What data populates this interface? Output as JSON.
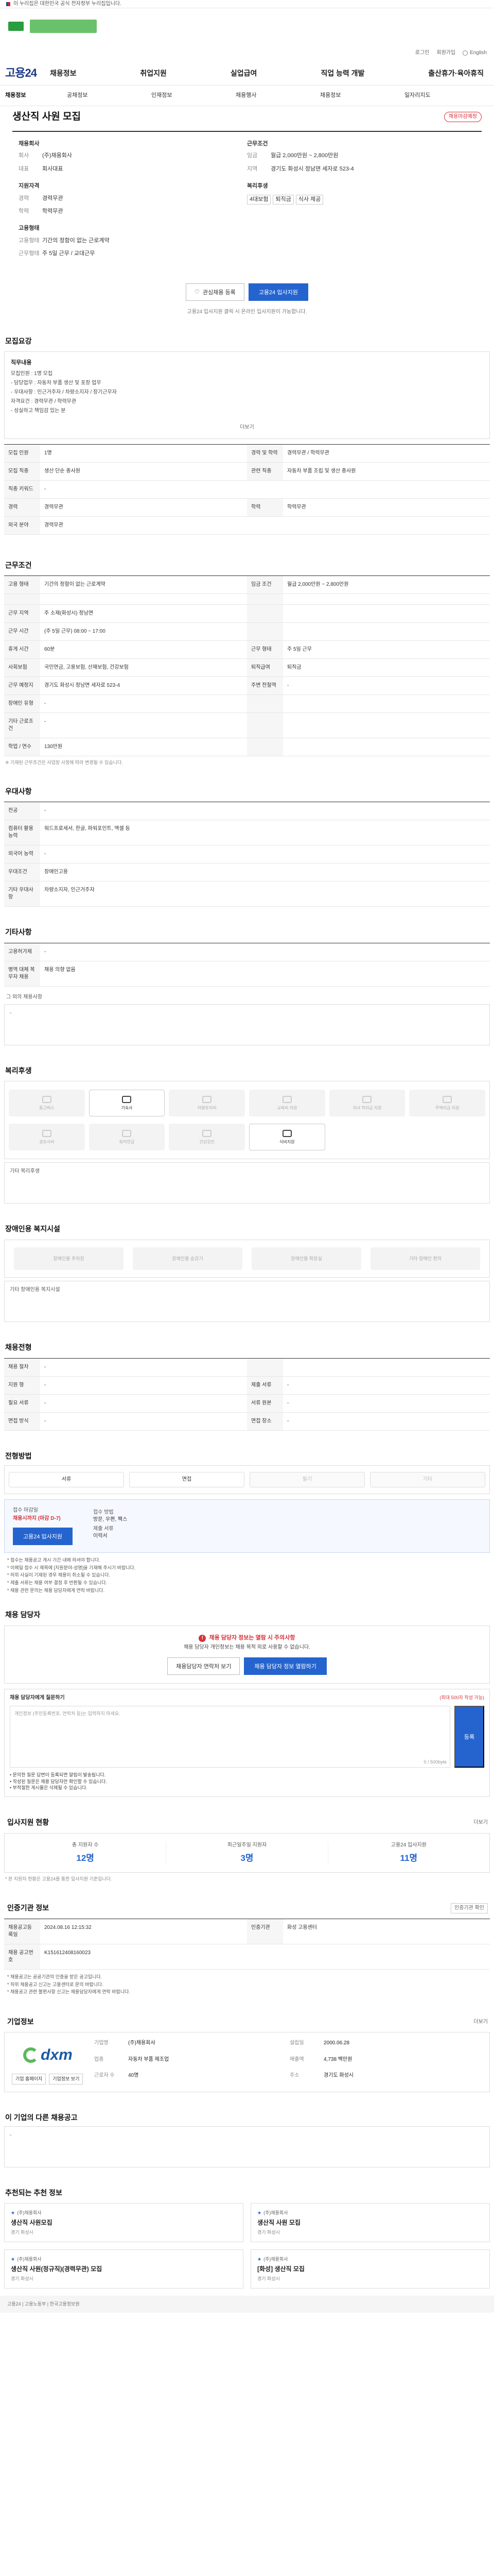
{
  "gov_bar": {
    "text": "이 누리집은 대한민국 공식 전자정부 누리집입니다."
  },
  "util": {
    "links": [
      "로그인",
      "회원가입",
      "English"
    ]
  },
  "header": {
    "logo": "고용24",
    "gnb": [
      "채용정보",
      "취업지원",
      "실업급여",
      "직업 능력 개발",
      "출산휴가·육아휴직"
    ]
  },
  "subnav": [
    "채용정보",
    "공채정보",
    "인재정보",
    "채용행사",
    "채용정보",
    "일자리지도"
  ],
  "title": {
    "text": "생산직 사원 모집",
    "badge": "채용마감예정"
  },
  "summary": {
    "company_head": "채용회사",
    "company_rows": [
      {
        "k": "회사",
        "v": "(주)채용회사"
      },
      {
        "k": "대표",
        "v": "회사대표"
      }
    ],
    "conditions_head": "근무조건",
    "conditions_rows": [
      {
        "k": "임금",
        "v": "월급 2,000만원 ~ 2,800만원"
      },
      {
        "k": "지역",
        "v": "경기도 화성시 정남면 세자로 523-4"
      }
    ],
    "qual_head": "지원자격",
    "qual_rows": [
      {
        "k": "경력",
        "v": "경력무관"
      },
      {
        "k": "학력",
        "v": "학력무관"
      }
    ],
    "type_head": "고용형태",
    "type_rows": [
      {
        "k": "고용형태",
        "v": "기간의 정함이 없는 근로계약"
      },
      {
        "k": "근무형태",
        "v": "주 5일 근무 / 교대근무"
      }
    ],
    "benefit_head": "복리후생",
    "benefits": [
      "4대보험",
      "퇴직금",
      "식사 제공"
    ],
    "btn_save": "관심채용 등록",
    "btn_apply": "고용24 입사지원",
    "note": "고용24 입사지원 클릭 시 온라인 입사지원이 가능합니다."
  },
  "s_recruit": {
    "title": "모집요강",
    "card_head": "직무내용",
    "items": [
      "모집인원 : 1명 모집",
      "- 담당업무 : 자동차 부품 생산 및 포장 업무",
      "- 우대사항 : 인근거주자 / 차량소지자 / 장기근무자",
      "자격요건 : 경력무관 / 학력무관",
      "- 성실하고 책임감 있는 분"
    ],
    "more": "더보기",
    "rows": [
      [
        {
          "k": "모집 인원",
          "v": "1명"
        },
        {
          "k": "경력 및 학력",
          "v": "경력무관 / 학력무관"
        }
      ],
      [
        {
          "k": "모집 직종",
          "v": "생산 단순 종사원"
        },
        {
          "k": "관련 직종",
          "v": "자동차 부품 조립 및 생산 종사원"
        }
      ],
      [
        {
          "k": "직종 키워드",
          "v": "-"
        },
        {
          "k": "",
          "v": ""
        }
      ],
      [
        {
          "k": "경력",
          "v": "경력무관"
        },
        {
          "k": "학력",
          "v": "학력무관"
        }
      ],
      [
        {
          "k": "외국 분야",
          "v": "경력무관"
        },
        {
          "k": "",
          "v": ""
        }
      ]
    ]
  },
  "s_work": {
    "title": "근무조건",
    "rows": [
      [
        {
          "k": "고용 형태",
          "v": "기간의 정함이 없는 근로계약"
        },
        {
          "k": "임금 조건",
          "v": "월급 2,000만원 ~ 2,800만원"
        }
      ],
      [
        {
          "k": "",
          "v": ""
        },
        {
          "k": "",
          "v": ""
        }
      ],
      [
        {
          "k": "근무 지역",
          "v": "주 소재(화성시) 정남면"
        },
        {
          "k": "",
          "v": ""
        }
      ],
      [
        {
          "k": "근무 시간",
          "v": "(주 5일 근무) 08:00 ~ 17:00"
        },
        {
          "k": "",
          "v": ""
        }
      ],
      [
        {
          "k": "휴게 시간",
          "v": "60분"
        },
        {
          "k": "근무 형태",
          "v": "주 5일 근무"
        }
      ],
      [
        {
          "k": "사회보험",
          "v": "국민연금, 고용보험, 산재보험, 건강보험"
        },
        {
          "k": "퇴직급여",
          "v": "퇴직금"
        }
      ],
      [
        {
          "k": "근무 예정지",
          "v": "경기도 화성시 정남면 세자로 523-4"
        },
        {
          "k": "주변 전철역",
          "v": "-"
        }
      ],
      [
        {
          "k": "장애인 유형",
          "v": "-"
        },
        {
          "k": "",
          "v": ""
        }
      ],
      [
        {
          "k": "기타 근로조건",
          "v": "-"
        },
        {
          "k": "",
          "v": ""
        }
      ],
      [
        {
          "k": "학업 / 연수",
          "v": "130만원"
        },
        {
          "k": "",
          "v": ""
        }
      ]
    ],
    "note": "※ 기재된 근무조건은 사업장 사정에 따라 변경될 수 있습니다."
  },
  "s_pref": {
    "title": "우대사항",
    "rows": [
      [
        {
          "k": "전공",
          "v": "-"
        }
      ],
      [
        {
          "k": "컴퓨터 활용 능력",
          "v": "워드프로세서, 한글, 파워포인트, 엑셀 등"
        }
      ],
      [
        {
          "k": "외국어 능력",
          "v": "-"
        }
      ],
      [
        {
          "k": "우대조건",
          "v": "장애인고용"
        }
      ],
      [
        {
          "k": "기타 우대사항",
          "v": "차량소지자, 인근거주자"
        }
      ]
    ]
  },
  "s_etc": {
    "title": "기타사항",
    "rows": [
      [
        {
          "k": "고용허가제",
          "v": "-"
        }
      ],
      [
        {
          "k": "병역 대체 복무자 채용",
          "v": "채용 의향 없음"
        }
      ]
    ],
    "empty": "그 외의 채용사항"
  },
  "s_benefit": {
    "title": "복리후생",
    "icons": [
      {
        "label": "통근버스",
        "on": false
      },
      {
        "label": "기숙사",
        "on": true
      },
      {
        "label": "차량유지비",
        "on": false
      },
      {
        "label": "교육비 지원",
        "on": false
      },
      {
        "label": "자녀 학자금 지원",
        "on": false
      },
      {
        "label": "주택자금 지원",
        "on": false
      },
      {
        "label": "경조사비",
        "on": false
      },
      {
        "label": "퇴직연금",
        "on": false
      },
      {
        "label": "건강검진",
        "on": false
      },
      {
        "label": "식비지원",
        "on": true
      }
    ],
    "empty": "기타 복리후생"
  },
  "s_disabled": {
    "title": "장애인용 복지시설",
    "chips": [
      "장애인용 주차장",
      "장애인용 승강기",
      "장애인용 화장실",
      "기타 장애인 편의"
    ],
    "empty": "기타 장애인용 복지시설"
  },
  "s_process": {
    "title": "채용전형",
    "rows": [
      [
        {
          "k": "채용 절차",
          "v": "-"
        },
        {
          "k": "",
          "v": ""
        }
      ],
      [
        {
          "k": "지원 형",
          "v": "-"
        },
        {
          "k": "제출 서류",
          "v": "-"
        }
      ],
      [
        {
          "k": "필요 서류",
          "v": "-"
        },
        {
          "k": "서류 원본",
          "v": "-"
        }
      ],
      [
        {
          "k": "면접 방식",
          "v": "-"
        },
        {
          "k": "면접 장소",
          "v": "-"
        }
      ]
    ]
  },
  "s_method": {
    "title": "전형방법",
    "methods": [
      {
        "label": "서류",
        "on": true
      },
      {
        "label": "면접",
        "on": true
      },
      {
        "label": "필기",
        "on": false
      },
      {
        "label": "기타",
        "on": false
      }
    ],
    "apply_deadline_k": "접수 마감일",
    "apply_deadline_v": "채용시까지 (마감 D-7)",
    "apply_method_k": "접수 방법",
    "apply_method_v": "방문, 우편, 팩스",
    "submit_k": "제출 서류",
    "submit_v": "이력서",
    "btn": "고용24 입사지원",
    "notes": [
      "* 접수는 채용공고 게시 기간 내에 하셔야 합니다.",
      "* 이메일 접수 시 제목에 [지원분야-성명]을 기재해 주시기 바랍니다.",
      "* 허위 사실이 기재된 경우 채용이 취소될 수 있습니다.",
      "* 제출 서류는 채용 여부 결정 후 반환될 수 있습니다.",
      "* 채용 관련 문의는 채용 담당자에게 연락 바랍니다."
    ]
  },
  "s_contact": {
    "title": "채용 담당자",
    "warn_title": "채용 담당자 정보는 열람 시 주의사항",
    "warn_text": "채용 담당자 개인정보는 채용 목적 외로 사용할 수 없습니다.",
    "btn1": "채용담당자 연락처 보기",
    "btn2": "채용 담당자 정보 열람하기",
    "comment_head": "채용 담당자에게 질문하기",
    "comment_hint": "(최대 500자 작성 가능)",
    "comment_placeholder": "개인정보 (주민등록번호, 연락처 등)는 입력하지 마세요.",
    "comment_count": "0 / 500byte",
    "comment_btn": "등록",
    "comment_list": [
      "• 문의한 질문 답변이 등록되면 알림이 발송됩니다.",
      "• 작성된 질문은 채용 담당자만 확인할 수 있습니다.",
      "• 부적절한 게시물은 삭제될 수 있습니다."
    ]
  },
  "s_stats": {
    "title": "입사지원 현황",
    "more": "더보기",
    "items": [
      {
        "k": "총 지원자 수",
        "v": "12명"
      },
      {
        "k": "최근일주일 지원자",
        "v": "3명"
      },
      {
        "k": "고용24 입사지원",
        "v": "11명"
      }
    ],
    "note": "* 본 지원자 현황은 고용24를 통한 입사지원 기준입니다."
  },
  "s_info": {
    "title": "인증기관 정보",
    "btn": "인증기관 확인",
    "rows": [
      [
        {
          "k": "채용공고등록일",
          "v": "2024.08.16 12:15:32"
        },
        {
          "k": "인증기관",
          "v": "화성 고용센터"
        }
      ],
      [
        {
          "k": "채용 공고번호",
          "v": "K151612408160023"
        },
        {
          "k": "",
          "v": ""
        }
      ]
    ],
    "notes": [
      "* 채용공고는 공공기관의 인증을 받은 공고입니다.",
      "* 허위 채용공고 신고는 고용센터로 문의 바랍니다.",
      "* 채용공고 관련 불편사항 신고는 채용담당자에게 연락 바랍니다."
    ]
  },
  "s_company": {
    "title": "기업정보",
    "more": "더보기",
    "logo_text": "dxm",
    "info": [
      {
        "k": "기업명",
        "v": "(주)채용회사"
      },
      {
        "k": "설립일",
        "v": "2000.06.28"
      },
      {
        "k": "업종",
        "v": "자동차 부품 제조업"
      },
      {
        "k": "매출액",
        "v": "4,738 백만원"
      },
      {
        "k": "근로자 수",
        "v": "40명"
      },
      {
        "k": "주소",
        "v": "경기도 화성시"
      }
    ],
    "btns": [
      "기업 홈페이지",
      "기업정보 보기"
    ]
  },
  "s_other": {
    "title": "이 기업의 다른 채용공고",
    "empty": "-"
  },
  "s_similar": {
    "title": "추천되는 추천 정보",
    "jobs": [
      {
        "co": "(주)채용회사",
        "t": "생산직 사원모집",
        "m": "경기 화성시"
      },
      {
        "co": "(주)채용회사",
        "t": "생산직 사원 모집",
        "m": "경기 화성시"
      },
      {
        "co": "(주)채용회사",
        "t": "생산직 사원(정규직)(경력무관) 모집",
        "m": "경기 화성시"
      },
      {
        "co": "(주)채용회사",
        "t": "[화성] 생산직 모집",
        "m": "경기 화성시"
      }
    ]
  },
  "footer": {
    "text": "고용24 | 고용노동부 | 한국고용정보원"
  }
}
